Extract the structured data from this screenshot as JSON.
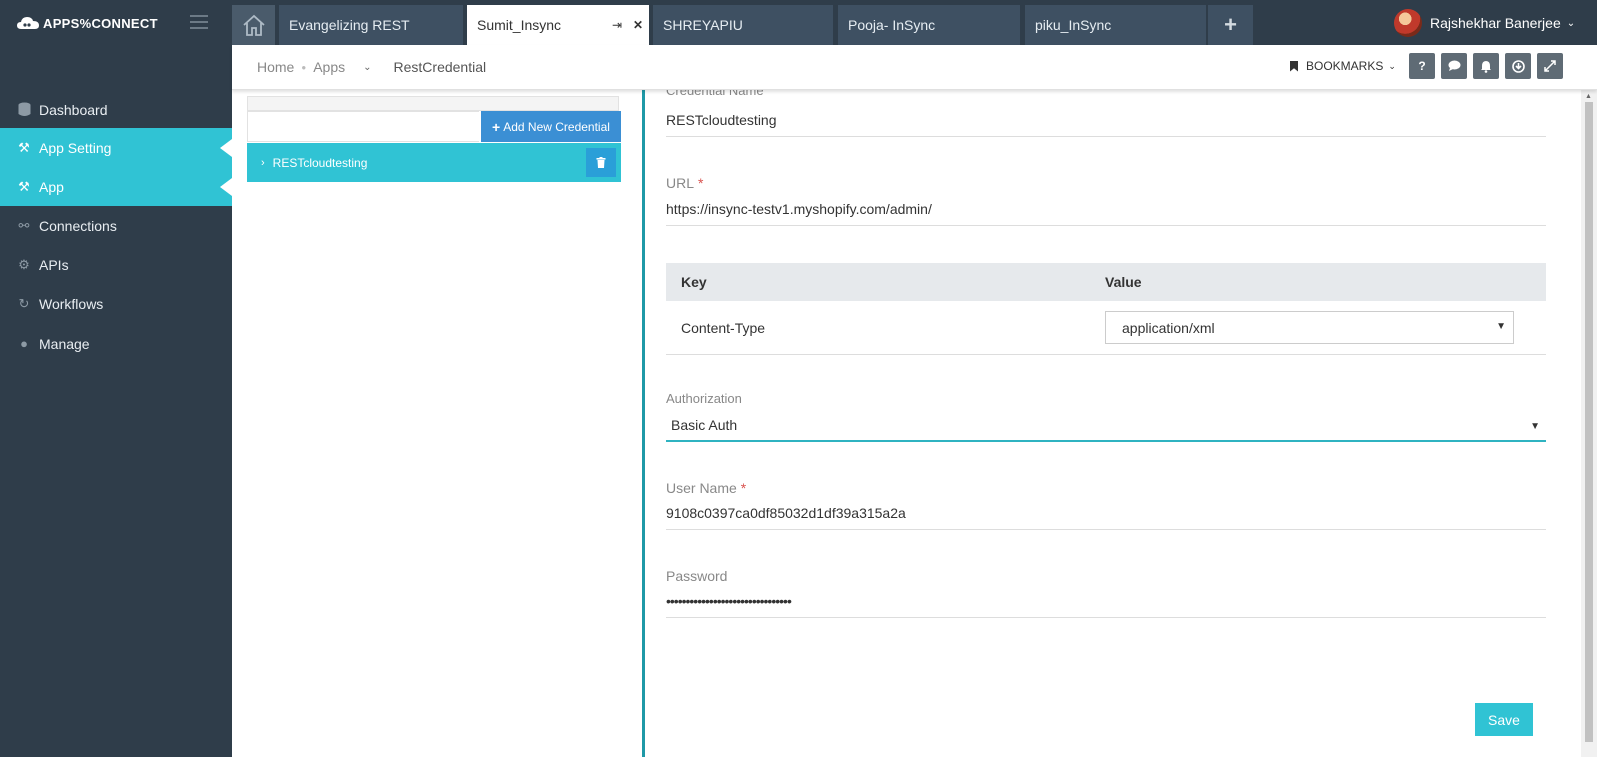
{
  "app": {
    "logo_text": "APPS%CONNECT"
  },
  "topbar": {
    "tabs": [
      {
        "label": "Evangelizing REST"
      },
      {
        "label": "Sumit_Insync"
      },
      {
        "label": "SHREYAPIU"
      },
      {
        "label": "Pooja- InSync"
      },
      {
        "label": "piku_InSync"
      }
    ],
    "user_name": "Rajshekhar Banerjee"
  },
  "sidebar": {
    "items": [
      {
        "label": "Dashboard",
        "icon": "database-icon"
      },
      {
        "label": "App Setting",
        "icon": "app-setting-icon",
        "active": true
      },
      {
        "label": "App",
        "icon": "app-icon",
        "active": true
      },
      {
        "label": "Connections",
        "icon": "connections-icon"
      },
      {
        "label": "APIs",
        "icon": "apis-icon"
      },
      {
        "label": "Workflows",
        "icon": "workflows-icon"
      },
      {
        "label": "Manage",
        "icon": "manage-icon"
      }
    ]
  },
  "breadcrumb": {
    "home": "Home",
    "apps": "Apps",
    "current": "RestCredential"
  },
  "toolbar": {
    "bookmarks_label": "BOOKMARKS"
  },
  "credentials": {
    "add_button_label": "Add New Credential",
    "items": [
      {
        "name": "RESTcloudtesting"
      }
    ]
  },
  "form": {
    "credential_name_label": "Credential Name",
    "credential_name_value": "RESTcloudtesting",
    "url_label": "URL",
    "url_value": "https://insync-testv1.myshopify.com/admin/",
    "headers_table": {
      "columns": [
        "Key",
        "Value"
      ],
      "rows": [
        {
          "key": "Content-Type",
          "value": "application/xml"
        }
      ]
    },
    "authorization_label": "Authorization",
    "authorization_value": "Basic Auth",
    "username_label": "User Name",
    "username_value": "9108c0397ca0df85032d1df39a315a2a",
    "password_label": "Password",
    "password_value": "••••••••••••••••••••••••••••••••",
    "save_label": "Save"
  },
  "colors": {
    "sidebar_bg": "#2f3d4a",
    "accent": "#30c3d4",
    "button_blue": "#3b8fd4",
    "required": "#d9534f"
  }
}
